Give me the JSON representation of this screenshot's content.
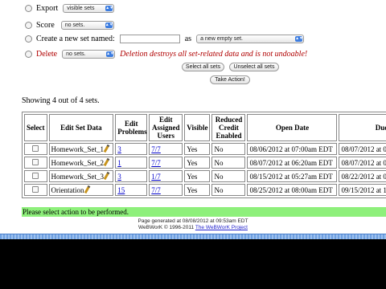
{
  "options": {
    "export": {
      "label": "Export",
      "select_value": "visible sets"
    },
    "score": {
      "label": "Score",
      "select_value": "no sets."
    },
    "create": {
      "label": "Create a new set named:",
      "as_label": "as",
      "select_value": "a new empty set."
    },
    "delete": {
      "label": "Delete",
      "select_value": "no sets.",
      "warning": "Deletion destroys all set-related data and is not undoable!"
    }
  },
  "buttons": {
    "select_all": "Select all sets",
    "unselect_all": "Unselect all sets",
    "take_action": "Take Action!"
  },
  "showing_text": "Showing 4 out of 4 sets.",
  "table": {
    "headers": {
      "select": "Select",
      "edit_set": "Edit Set Data",
      "edit_problems": "Edit Problems",
      "edit_assigned": "Edit Assigned Users",
      "visible": "Visible",
      "reduced": "Reduced Credit Enabled",
      "open_date": "Open Date",
      "due_date": "Due D"
    },
    "rows": [
      {
        "name": "Homework_Set_1",
        "problems": "3",
        "assigned": "7/7",
        "visible": "Yes",
        "reduced": "No",
        "open": "08/06/2012 at 07:00am EDT",
        "due": "08/07/2012 at 0"
      },
      {
        "name": "Homework_Set_2",
        "problems": "1",
        "assigned": "7/7",
        "visible": "Yes",
        "reduced": "No",
        "open": "08/07/2012 at 06:20am EDT",
        "due": "08/07/2012 at 0"
      },
      {
        "name": "Homework_Set_3",
        "problems": "3",
        "assigned": "1/7",
        "visible": "Yes",
        "reduced": "No",
        "open": "08/15/2012 at 05:27am EDT",
        "due": "08/22/2012 at 0"
      },
      {
        "name": "Orientation",
        "problems": "15",
        "assigned": "7/7",
        "visible": "Yes",
        "reduced": "No",
        "open": "08/25/2012 at 08:00am EDT",
        "due": "09/15/2012 at 1"
      }
    ]
  },
  "status_message": "Please select action to be performed.",
  "footer": {
    "generated": "Page generated at 08/08/2012 at 09:53am EDT",
    "copyright": "WeBWorK © 1996-2011",
    "link": "The WeBWorK Project"
  }
}
